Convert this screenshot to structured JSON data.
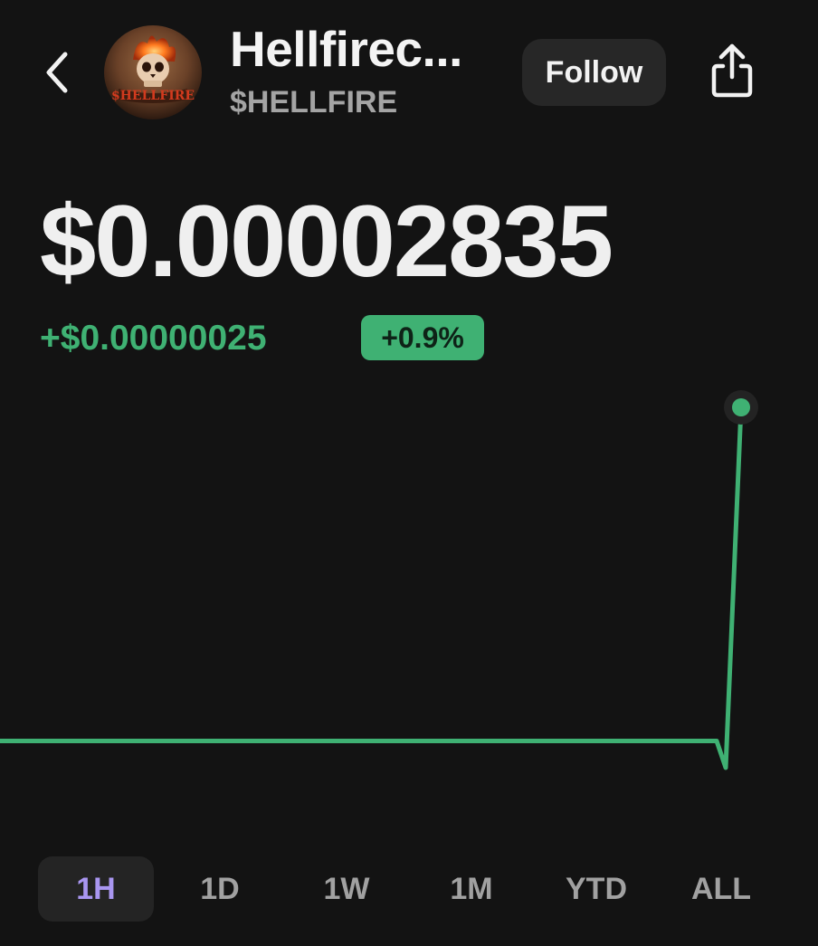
{
  "header": {
    "back_icon": "chevron-left-icon",
    "avatar_text": "$HELLFIRE",
    "title": "Hellfirec...",
    "ticker": "$HELLFIRE",
    "follow_label": "Follow",
    "share_icon": "share-icon"
  },
  "price": {
    "value": "$0.00002835",
    "change_abs": "+$0.00000025",
    "change_pct": "+0.9%"
  },
  "colors": {
    "background": "#131313",
    "positive": "#3fb173",
    "active_tab_text": "#a996f0"
  },
  "chart_data": {
    "type": "line",
    "series": [
      {
        "values": [
          2.81e-05,
          2.81e-05,
          2.81e-05,
          2.81e-05,
          2.81e-05,
          2.81e-05,
          2.81e-05,
          2.81e-05,
          2.81e-05,
          2.81e-05,
          2.81e-05,
          2.808e-05,
          2.835e-05
        ]
      }
    ],
    "last_point_marker": true,
    "grid": false
  },
  "ranges": {
    "items": [
      "1H",
      "1D",
      "1W",
      "1M",
      "YTD",
      "ALL"
    ],
    "selected": "1H"
  }
}
